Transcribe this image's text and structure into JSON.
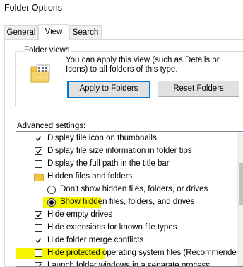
{
  "window": {
    "title": "Folder Options"
  },
  "tabs": [
    {
      "label": "General"
    },
    {
      "label": "View"
    },
    {
      "label": "Search"
    }
  ],
  "folder_views": {
    "legend": "Folder views",
    "description": "You can apply this view (such as Details or Icons) to all folders of this type.",
    "apply_button": "Apply to Folders",
    "reset_button": "Reset Folders"
  },
  "advanced": {
    "label": "Advanced settings:",
    "items": [
      {
        "type": "checkbox",
        "checked": true,
        "label": "Display file icon on thumbnails"
      },
      {
        "type": "checkbox",
        "checked": true,
        "label": "Display file size information in folder tips"
      },
      {
        "type": "checkbox",
        "checked": false,
        "label": "Display the full path in the title bar"
      },
      {
        "type": "folder",
        "label": "Hidden files and folders"
      },
      {
        "type": "radio",
        "checked": false,
        "label": "Don't show hidden files, folders, or drives"
      },
      {
        "type": "radio",
        "checked": true,
        "label": "Show hidden files, folders, and drives",
        "highlight": "Show hidden"
      },
      {
        "type": "checkbox",
        "checked": true,
        "label": "Hide empty drives"
      },
      {
        "type": "checkbox",
        "checked": false,
        "label": "Hide extensions for known file types"
      },
      {
        "type": "checkbox",
        "checked": true,
        "label": "Hide folder merge conflicts"
      },
      {
        "type": "checkbox",
        "checked": false,
        "label": "Hide protected operating system files (Recommended)",
        "highlight": "Hide protected"
      },
      {
        "type": "checkbox",
        "checked": true,
        "label": "Launch folder windows in a separate process"
      }
    ]
  },
  "colors": {
    "highlight": "#f5f500",
    "primary_border": "#0078d7",
    "folder": "#f3c542"
  }
}
